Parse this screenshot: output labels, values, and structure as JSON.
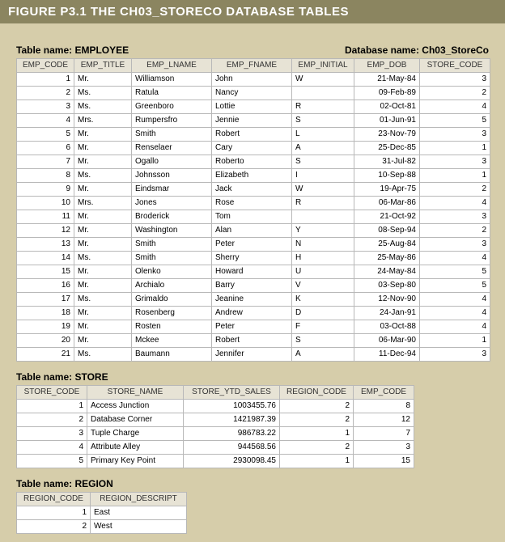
{
  "figure_title": "FIGURE P3.1  THE CH03_STORECO DATABASE TABLES",
  "database_label": "Database name: Ch03_StoreCo",
  "employee": {
    "label": "Table name: EMPLOYEE",
    "headers": [
      "EMP_CODE",
      "EMP_TITLE",
      "EMP_LNAME",
      "EMP_FNAME",
      "EMP_INITIAL",
      "EMP_DOB",
      "STORE_CODE"
    ],
    "rows": [
      [
        "1",
        "Mr.",
        "Williamson",
        "John",
        "W",
        "21-May-84",
        "3"
      ],
      [
        "2",
        "Ms.",
        "Ratula",
        "Nancy",
        "",
        "09-Feb-89",
        "2"
      ],
      [
        "3",
        "Ms.",
        "Greenboro",
        "Lottie",
        "R",
        "02-Oct-81",
        "4"
      ],
      [
        "4",
        "Mrs.",
        "Rumpersfro",
        "Jennie",
        "S",
        "01-Jun-91",
        "5"
      ],
      [
        "5",
        "Mr.",
        "Smith",
        "Robert",
        "L",
        "23-Nov-79",
        "3"
      ],
      [
        "6",
        "Mr.",
        "Renselaer",
        "Cary",
        "A",
        "25-Dec-85",
        "1"
      ],
      [
        "7",
        "Mr.",
        "Ogallo",
        "Roberto",
        "S",
        "31-Jul-82",
        "3"
      ],
      [
        "8",
        "Ms.",
        "Johnsson",
        "Elizabeth",
        "I",
        "10-Sep-88",
        "1"
      ],
      [
        "9",
        "Mr.",
        "Eindsmar",
        "Jack",
        "W",
        "19-Apr-75",
        "2"
      ],
      [
        "10",
        "Mrs.",
        "Jones",
        "Rose",
        "R",
        "06-Mar-86",
        "4"
      ],
      [
        "11",
        "Mr.",
        "Broderick",
        "Tom",
        "",
        "21-Oct-92",
        "3"
      ],
      [
        "12",
        "Mr.",
        "Washington",
        "Alan",
        "Y",
        "08-Sep-94",
        "2"
      ],
      [
        "13",
        "Mr.",
        "Smith",
        "Peter",
        "N",
        "25-Aug-84",
        "3"
      ],
      [
        "14",
        "Ms.",
        "Smith",
        "Sherry",
        "H",
        "25-May-86",
        "4"
      ],
      [
        "15",
        "Mr.",
        "Olenko",
        "Howard",
        "U",
        "24-May-84",
        "5"
      ],
      [
        "16",
        "Mr.",
        "Archialo",
        "Barry",
        "V",
        "03-Sep-80",
        "5"
      ],
      [
        "17",
        "Ms.",
        "Grimaldo",
        "Jeanine",
        "K",
        "12-Nov-90",
        "4"
      ],
      [
        "18",
        "Mr.",
        "Rosenberg",
        "Andrew",
        "D",
        "24-Jan-91",
        "4"
      ],
      [
        "19",
        "Mr.",
        "Rosten",
        "Peter",
        "F",
        "03-Oct-88",
        "4"
      ],
      [
        "20",
        "Mr.",
        "Mckee",
        "Robert",
        "S",
        "06-Mar-90",
        "1"
      ],
      [
        "21",
        "Ms.",
        "Baumann",
        "Jennifer",
        "A",
        "11-Dec-94",
        "3"
      ]
    ]
  },
  "store": {
    "label": "Table name: STORE",
    "headers": [
      "STORE_CODE",
      "STORE_NAME",
      "STORE_YTD_SALES",
      "REGION_CODE",
      "EMP_CODE"
    ],
    "rows": [
      [
        "1",
        "Access Junction",
        "1003455.76",
        "2",
        "8"
      ],
      [
        "2",
        "Database Corner",
        "1421987.39",
        "2",
        "12"
      ],
      [
        "3",
        "Tuple Charge",
        "986783.22",
        "1",
        "7"
      ],
      [
        "4",
        "Attribute Alley",
        "944568.56",
        "2",
        "3"
      ],
      [
        "5",
        "Primary Key Point",
        "2930098.45",
        "1",
        "15"
      ]
    ]
  },
  "region": {
    "label": "Table name: REGION",
    "headers": [
      "REGION_CODE",
      "REGION_DESCRIPT"
    ],
    "rows": [
      [
        "1",
        "East"
      ],
      [
        "2",
        "West"
      ]
    ]
  },
  "chart_data": {
    "type": "table",
    "tables": [
      {
        "name": "EMPLOYEE",
        "columns": [
          "EMP_CODE",
          "EMP_TITLE",
          "EMP_LNAME",
          "EMP_FNAME",
          "EMP_INITIAL",
          "EMP_DOB",
          "STORE_CODE"
        ],
        "rows": [
          [
            1,
            "Mr.",
            "Williamson",
            "John",
            "W",
            "21-May-84",
            3
          ],
          [
            2,
            "Ms.",
            "Ratula",
            "Nancy",
            "",
            "09-Feb-89",
            2
          ],
          [
            3,
            "Ms.",
            "Greenboro",
            "Lottie",
            "R",
            "02-Oct-81",
            4
          ],
          [
            4,
            "Mrs.",
            "Rumpersfro",
            "Jennie",
            "S",
            "01-Jun-91",
            5
          ],
          [
            5,
            "Mr.",
            "Smith",
            "Robert",
            "L",
            "23-Nov-79",
            3
          ],
          [
            6,
            "Mr.",
            "Renselaer",
            "Cary",
            "A",
            "25-Dec-85",
            1
          ],
          [
            7,
            "Mr.",
            "Ogallo",
            "Roberto",
            "S",
            "31-Jul-82",
            3
          ],
          [
            8,
            "Ms.",
            "Johnsson",
            "Elizabeth",
            "I",
            "10-Sep-88",
            1
          ],
          [
            9,
            "Mr.",
            "Eindsmar",
            "Jack",
            "W",
            "19-Apr-75",
            2
          ],
          [
            10,
            "Mrs.",
            "Jones",
            "Rose",
            "R",
            "06-Mar-86",
            4
          ],
          [
            11,
            "Mr.",
            "Broderick",
            "Tom",
            "",
            "21-Oct-92",
            3
          ],
          [
            12,
            "Mr.",
            "Washington",
            "Alan",
            "Y",
            "08-Sep-94",
            2
          ],
          [
            13,
            "Mr.",
            "Smith",
            "Peter",
            "N",
            "25-Aug-84",
            3
          ],
          [
            14,
            "Ms.",
            "Smith",
            "Sherry",
            "H",
            "25-May-86",
            4
          ],
          [
            15,
            "Mr.",
            "Olenko",
            "Howard",
            "U",
            "24-May-84",
            5
          ],
          [
            16,
            "Mr.",
            "Archialo",
            "Barry",
            "V",
            "03-Sep-80",
            5
          ],
          [
            17,
            "Ms.",
            "Grimaldo",
            "Jeanine",
            "K",
            "12-Nov-90",
            4
          ],
          [
            18,
            "Mr.",
            "Rosenberg",
            "Andrew",
            "D",
            "24-Jan-91",
            4
          ],
          [
            19,
            "Mr.",
            "Rosten",
            "Peter",
            "F",
            "03-Oct-88",
            4
          ],
          [
            20,
            "Mr.",
            "Mckee",
            "Robert",
            "S",
            "06-Mar-90",
            1
          ],
          [
            21,
            "Ms.",
            "Baumann",
            "Jennifer",
            "A",
            "11-Dec-94",
            3
          ]
        ]
      },
      {
        "name": "STORE",
        "columns": [
          "STORE_CODE",
          "STORE_NAME",
          "STORE_YTD_SALES",
          "REGION_CODE",
          "EMP_CODE"
        ],
        "rows": [
          [
            1,
            "Access Junction",
            1003455.76,
            2,
            8
          ],
          [
            2,
            "Database Corner",
            1421987.39,
            2,
            12
          ],
          [
            3,
            "Tuple Charge",
            986783.22,
            1,
            7
          ],
          [
            4,
            "Attribute Alley",
            944568.56,
            2,
            3
          ],
          [
            5,
            "Primary Key Point",
            2930098.45,
            1,
            15
          ]
        ]
      },
      {
        "name": "REGION",
        "columns": [
          "REGION_CODE",
          "REGION_DESCRIPT"
        ],
        "rows": [
          [
            1,
            "East"
          ],
          [
            2,
            "West"
          ]
        ]
      }
    ]
  }
}
